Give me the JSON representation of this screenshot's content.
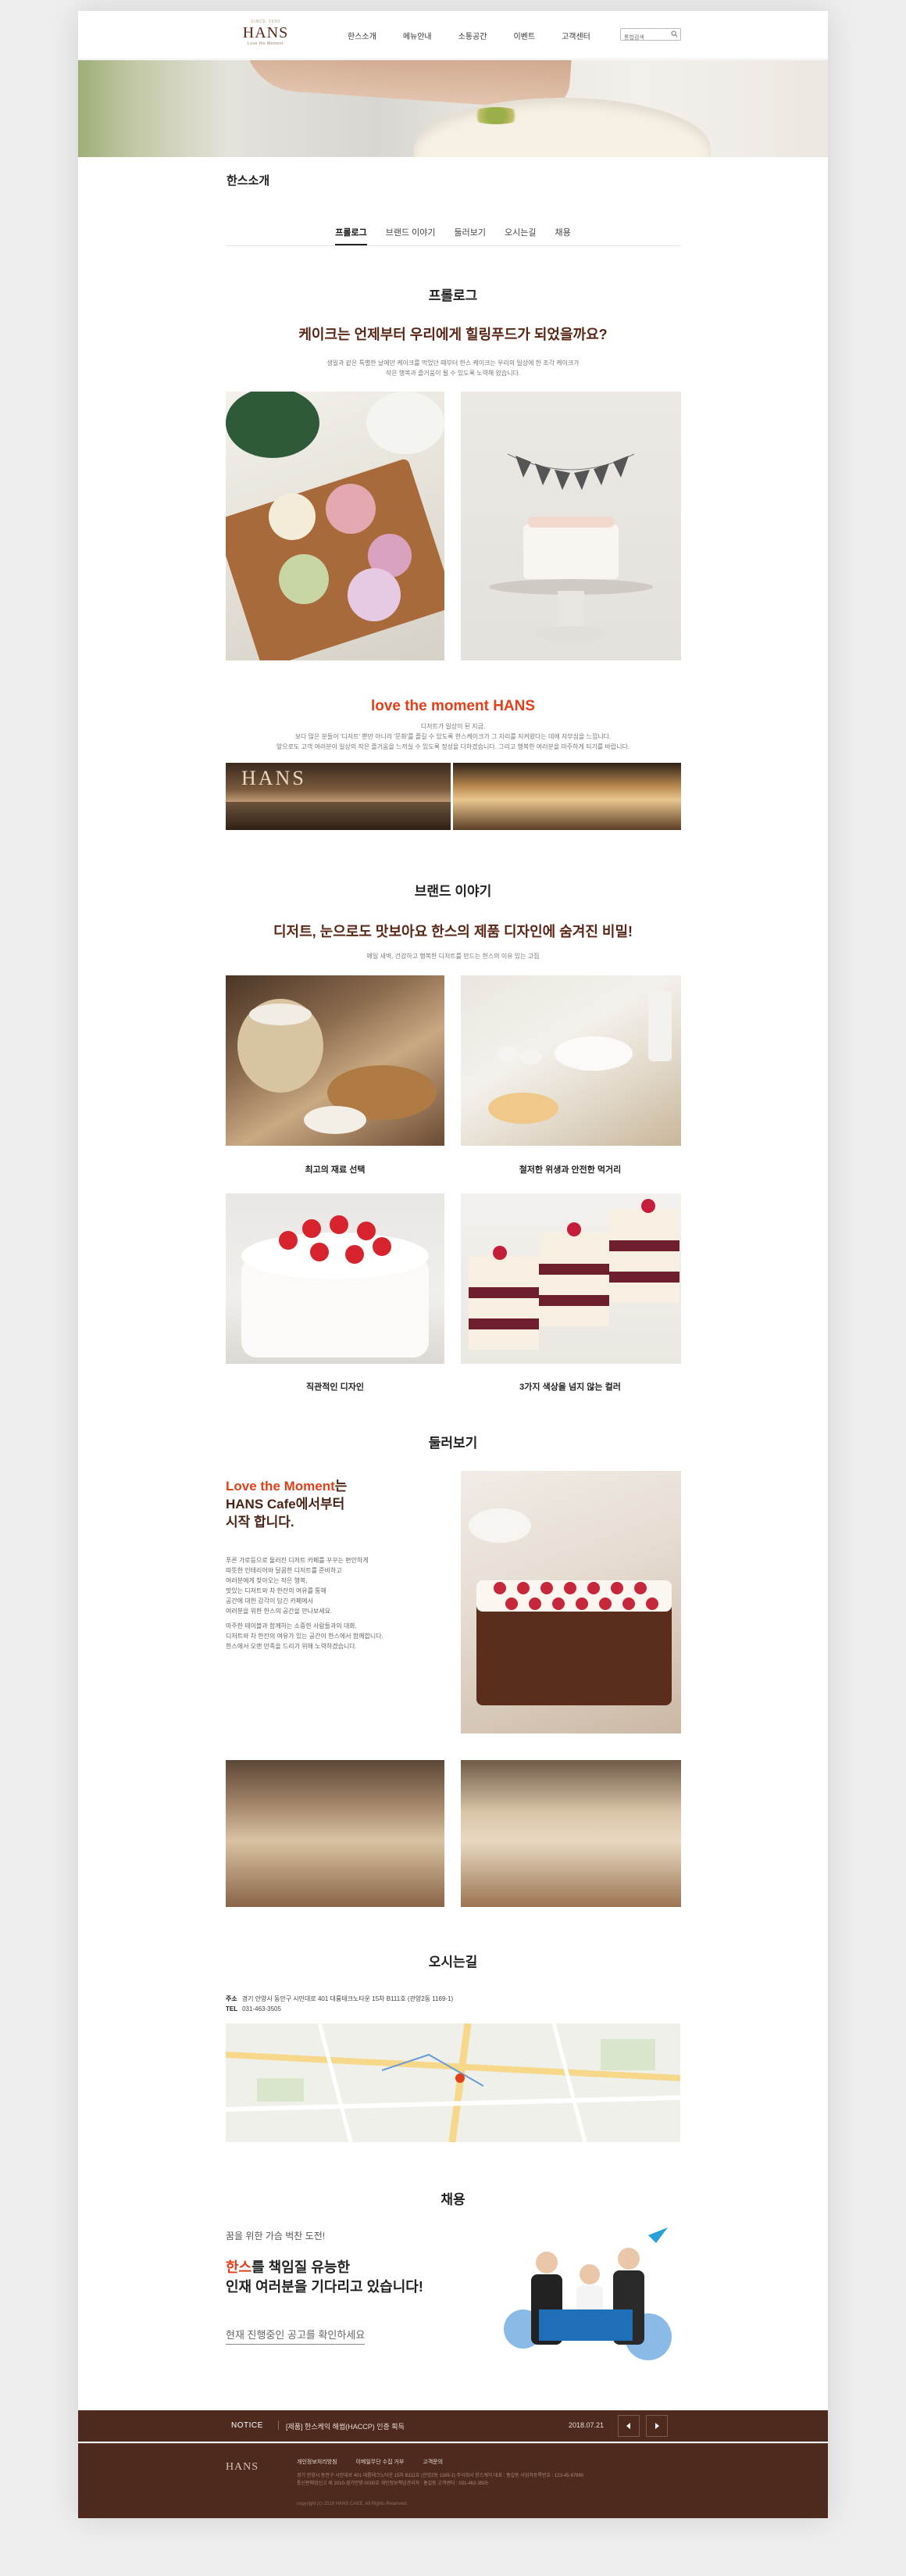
{
  "header": {
    "logo_top": "SINCE 1990",
    "logo_name": "HANS",
    "logo_sub": "Love the Moment",
    "nav": [
      "한스소개",
      "메뉴안내",
      "소통공간",
      "이벤트",
      "고객센터"
    ],
    "search_placeholder": "통합검색"
  },
  "page_title": "한스소개",
  "tabs": [
    "프롤로그",
    "브랜드 이야기",
    "둘러보기",
    "오시는길",
    "채용"
  ],
  "prologue": {
    "title": "프롤로그",
    "headline": "케이크는 언제부터 우리에게 힐링푸드가 되었을까요?",
    "desc_1": "생일과 같은 특별한 날에만 케이크를 먹었던 때부터 한스 케이크는 우리의 일상에 한 조각 케이크가",
    "desc_2": "작은 행복과 즐거움이 될 수 있도록 노력해 왔습니다.",
    "moment_prefix": "love the moment",
    "moment_brand": "HANS",
    "moment_1": "디저트가 일상이 된 지금,",
    "moment_2": "보다 많은 분들이 '디저트' 뿐만 아니라 '문화'를 즐길 수 있도록 한스케이크가 그 자리를 지켜왔다는 데에 자부심을 느낍니다.",
    "moment_3": "앞으로도 고객 여러분이 일상의 작은 즐거움을 느끼실 수 있도록 정성을 다하겠습니다. 그리고 행복한 여러분을 마주하게 되기를 바랍니다."
  },
  "brand": {
    "title": "브랜드 이야기",
    "headline": "디저트, 눈으로도 맛보아요 한스의 제품 디자인에 숨겨진 비밀!",
    "desc": "매일 새벽, 건강하고 행복한 디저트를 만드는 한스의 이유 있는 고집",
    "captions": [
      "최고의 재료 선택",
      "철저한 위생과 안전한 먹거리",
      "직관적인 디자인",
      "3가지 색상을 넘지 않는 컬러"
    ]
  },
  "tour": {
    "title": "둘러보기",
    "head_red": "Love the Moment",
    "head_1": "는",
    "head_2": "HANS Cafe에서부터",
    "head_3": "시작 합니다.",
    "text": [
      "푸른 가로등으로 둘러진 디저트 카페를 꾸꾸는 편안하게",
      "따뜻한 인테리어와 달콤한 디저트를 준비하고",
      "여러분에게 찾아오는 작은 행복,",
      "맛있는 디저트와 차 한잔의 여유를 통해",
      "공간에 대한 감각이 담긴 카페에서",
      "여러분을 위한 한스의 공간을 만나보세요."
    ],
    "text_2": [
      "마주한 테이블과 함께하는 소중한 사람들과의 대화,",
      "디저트와 차 한잔의 여유가 있는 공간이 한스에서 함께합니다.",
      "한스에서 오랜 만족을 드리기 위해 노력하겠습니다."
    ]
  },
  "location": {
    "title": "오시는길",
    "addr_label": "주소",
    "addr": "경기 안양시 동안구 시민대로 401 대륭테크노타운 15차 B111호 (관양2동 1169-1)",
    "tel_label": "TEL",
    "tel": "031-463-3505"
  },
  "recruit": {
    "title": "채용",
    "sub": "꿈을 위한 가슴 벅찬 도전!",
    "head_red": "한스",
    "head_1": "를 책임질 유능한",
    "head_2": "인재 여러분을 기다리고 있습니다!",
    "link": "현재 진행중인 공고를 확인하세요"
  },
  "notice": {
    "label": "NOTICE",
    "text": "[제품] 한스케익 해썹(HACCP) 인증 획득",
    "date": "2018.07.21"
  },
  "footer": {
    "links": [
      "개인정보처리방침",
      "이메일무단 수집 거부",
      "고객문의"
    ],
    "info_1": "경기 안양시 동안구 시민대로 401 대륭테크노타운 15차 B111호 (관양2동 1169-1) 주식회사 한스케익 대표 : 홍길동 사업자등록번호 : 123-45-67890",
    "info_2": "통신판매업신고 제 2010-경기안양-0000호 개인정보책임관리자 : 홍길동 고객센터 : 031-463-3505",
    "copyright": "copyright (c) 2018 HANS CAKE. All Rights Reserved."
  }
}
